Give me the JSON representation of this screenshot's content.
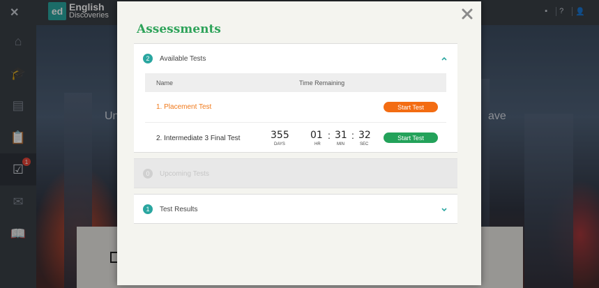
{
  "app": {
    "logo_badge": "ed",
    "logo_line1": "English",
    "logo_line2": "Discoveries",
    "close_glyph": "✕",
    "top_icons": [
      "flag-icon",
      "help-icon",
      "person-icon"
    ],
    "top_icon_glyphs": [
      "▪",
      "?",
      "👤"
    ],
    "bg_text_left": "Un",
    "bg_text_right": "ave",
    "sidebar": [
      {
        "icon": "home-icon",
        "glyph": "⌂"
      },
      {
        "icon": "graduation-cap-icon",
        "glyph": "🎓"
      },
      {
        "icon": "briefcase-icon",
        "glyph": "▤"
      },
      {
        "icon": "clipboard-icon",
        "glyph": "📋"
      },
      {
        "icon": "assessments-icon",
        "glyph": "☑",
        "badge": "1",
        "active": true
      },
      {
        "icon": "mail-icon",
        "glyph": "✉"
      },
      {
        "icon": "book-icon",
        "glyph": "📖"
      }
    ]
  },
  "modal": {
    "title": "Assessments",
    "close_icon": "close-icon",
    "available": {
      "count": "2",
      "label": "Available Tests",
      "expanded": true,
      "col_name": "Name",
      "col_time": "Time Remaining",
      "rows": [
        {
          "name": "1. Placement Test",
          "button": "Start Test"
        },
        {
          "name": "2. Intermediate 3 Final Test",
          "button": "Start Test",
          "days": "355",
          "days_label": "DAYS",
          "hr": "01",
          "hr_label": "HR",
          "min": "31",
          "min_label": "MIN",
          "sec": "32",
          "sec_label": "SEC"
        }
      ]
    },
    "upcoming": {
      "count": "0",
      "label": "Upcoming Tests"
    },
    "results": {
      "count": "1",
      "label": "Test Results",
      "expanded": false
    }
  },
  "colors": {
    "accent_green": "#2ea35a",
    "teal": "#2aa6a0",
    "orange": "#f36c12",
    "button_green": "#23a25a"
  }
}
